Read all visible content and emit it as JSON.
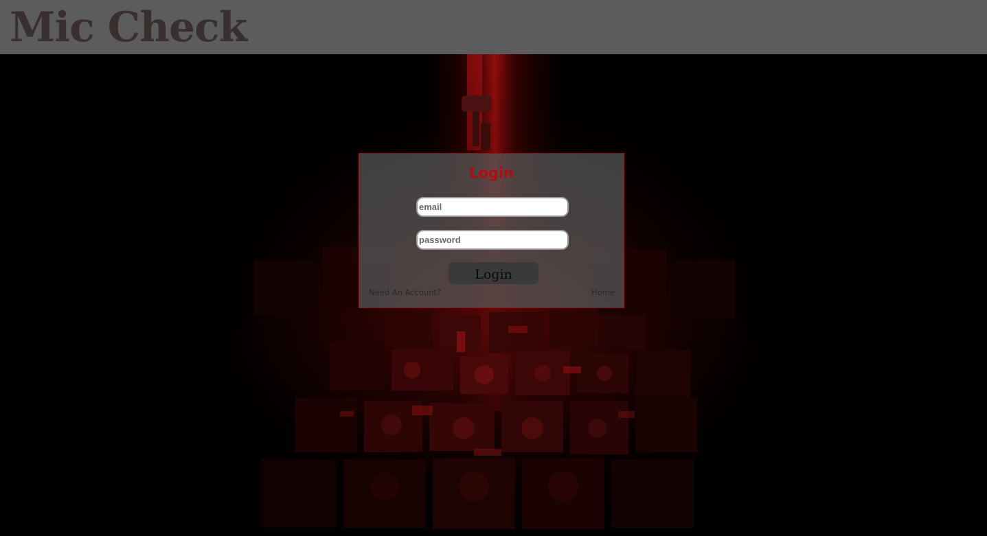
{
  "header": {
    "title": "Mic Check"
  },
  "login": {
    "heading": "Login",
    "email_placeholder": "email",
    "password_placeholder": "password",
    "submit_label": "Login",
    "signup_link": "Need An Account?",
    "home_link": "Home"
  },
  "colors": {
    "header_bg": "#5c5c5c",
    "title_text": "#3a2f2f",
    "accent_red": "#b00d10",
    "card_border": "#8a1a1a",
    "button_bg": "#3a3a3a"
  },
  "background": {
    "description_icon": "stacked-speakers-amps-art"
  }
}
